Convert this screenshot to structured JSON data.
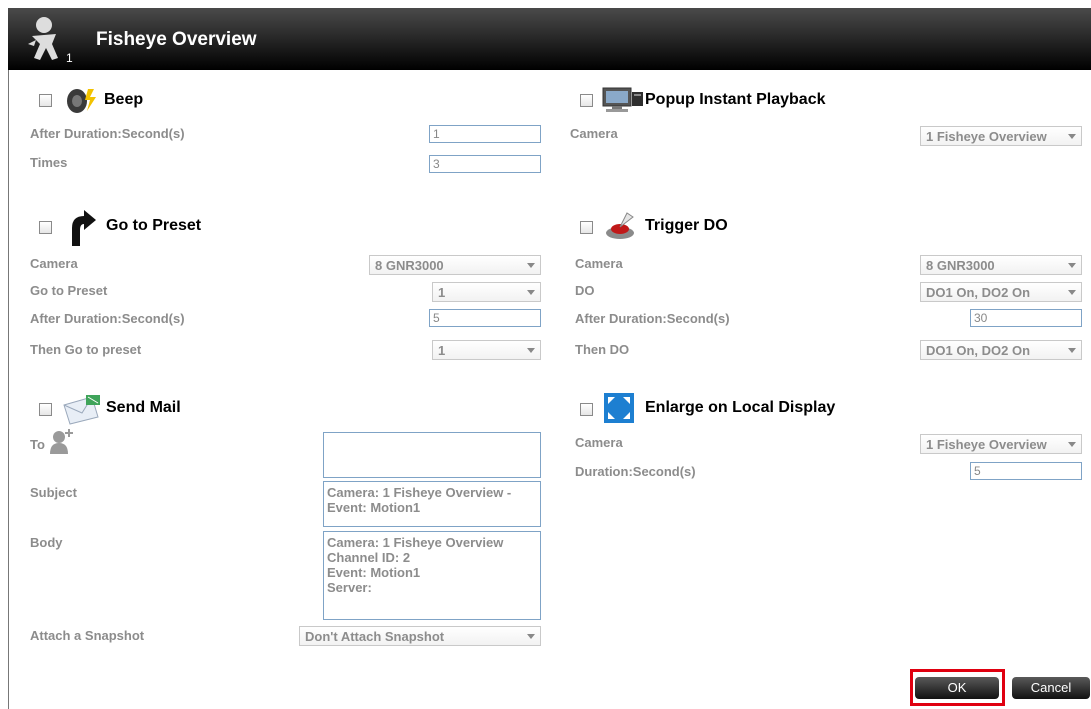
{
  "header": {
    "title": "Fisheye Overview"
  },
  "beep": {
    "title": "Beep",
    "after_label": "After Duration:Second(s)",
    "after_value": "1",
    "times_label": "Times",
    "times_value": "3"
  },
  "popup": {
    "title": "Popup Instant Playback",
    "camera_label": "Camera",
    "camera_value": "1 Fisheye Overview"
  },
  "preset": {
    "title": "Go to Preset",
    "camera_label": "Camera",
    "camera_value": "8 GNR3000",
    "goto_label": "Go to Preset",
    "goto_value": "1",
    "after_label": "After Duration:Second(s)",
    "after_value": "5",
    "then_label": "Then Go to preset",
    "then_value": "1"
  },
  "trigger": {
    "title": "Trigger DO",
    "camera_label": "Camera",
    "camera_value": "8 GNR3000",
    "do_label": "DO",
    "do_value": "DO1 On, DO2 On",
    "after_label": "After Duration:Second(s)",
    "after_value": "30",
    "then_label": "Then DO",
    "then_value": "DO1 On, DO2 On"
  },
  "mail": {
    "title": "Send Mail",
    "to_label": "To",
    "subject_label": "Subject",
    "subject_lines": [
      "Camera: 1 Fisheye Overview -",
      "Event: Motion1"
    ],
    "body_label": "Body",
    "body_lines": [
      "Camera: 1 Fisheye Overview",
      "Channel ID: 2",
      "Event: Motion1",
      "Server:"
    ],
    "attach_label": "Attach a Snapshot",
    "attach_value": "Don't Attach Snapshot"
  },
  "enlarge": {
    "title": "Enlarge on Local Display",
    "camera_label": "Camera",
    "camera_value": "1 Fisheye Overview",
    "duration_label": "Duration:Second(s)",
    "duration_value": "5"
  },
  "buttons": {
    "ok": "OK",
    "cancel": "Cancel"
  }
}
